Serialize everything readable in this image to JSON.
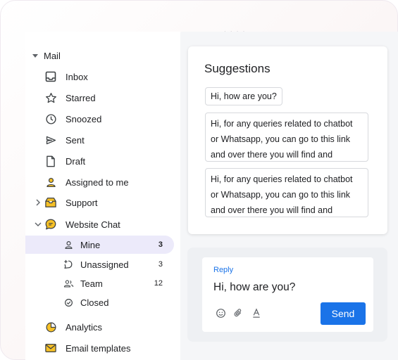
{
  "sidebar": {
    "mail_label": "Mail",
    "items": [
      {
        "label": "Inbox",
        "icon": "inbox-icon"
      },
      {
        "label": "Starred",
        "icon": "star-icon"
      },
      {
        "label": "Snoozed",
        "icon": "clock-icon"
      },
      {
        "label": "Sent",
        "icon": "send-icon"
      },
      {
        "label": "Draft",
        "icon": "draft-icon"
      },
      {
        "label": "Assigned to me",
        "icon": "person-icon"
      },
      {
        "label": "Support",
        "icon": "support-inbox-icon"
      },
      {
        "label": "Website Chat",
        "icon": "chat-icon"
      }
    ],
    "chat_subitems": [
      {
        "label": "Mine",
        "count": "3",
        "icon": "person-outline-icon"
      },
      {
        "label": "Unassigned",
        "count": "3",
        "icon": "unassigned-icon"
      },
      {
        "label": "Team",
        "count": "12",
        "icon": "team-icon"
      },
      {
        "label": "Closed",
        "count": "",
        "icon": "check-circle-icon"
      }
    ],
    "bottom_items": [
      {
        "label": "Analytics",
        "icon": "pie-chart-icon"
      },
      {
        "label": "Email templates",
        "icon": "template-icon"
      }
    ]
  },
  "suggestions": {
    "title": "Suggestions",
    "items": [
      "Hi, how are you?",
      "Hi, for any queries related to chatbot or Whatsapp, you can go to this link and over there you will find and truncate…",
      "Hi, for any queries related to chatbot or Whatsapp, you can go to this link and over there you will find and truncate…"
    ]
  },
  "reply": {
    "label": "Reply",
    "text": "Hi, how are you?",
    "send_label": "Send"
  },
  "colors": {
    "accent": "#1a73e8",
    "active_bg": "#eceafa",
    "icon_yellow": "#f6c026"
  }
}
